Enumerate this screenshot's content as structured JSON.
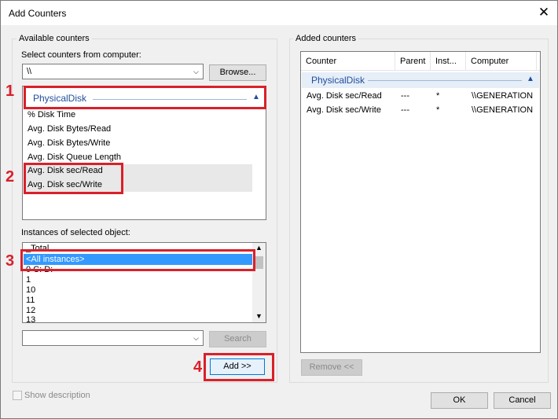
{
  "window": {
    "title": "Add Counters"
  },
  "available": {
    "group_label": "Available counters",
    "select_label": "Select counters from computer:",
    "computer_value": "\\\\",
    "browse_label": "Browse...",
    "object_name": "PhysicalDisk",
    "counters": [
      "% Disk Time",
      "Avg. Disk Bytes/Read",
      "Avg. Disk Bytes/Write",
      "Avg. Disk Queue Length",
      "Avg. Disk sec/Read",
      "Avg. Disk sec/Write"
    ],
    "instances_label": "Instances of selected object:",
    "instances": [
      "_Total",
      "<All instances>",
      "0 C: D:",
      "1",
      "10",
      "11",
      "12",
      "13"
    ],
    "search_value": "",
    "search_label": "Search",
    "add_label": "Add >>"
  },
  "added": {
    "group_label": "Added counters",
    "columns": [
      "Counter",
      "Parent",
      "Inst...",
      "Computer"
    ],
    "group_name": "PhysicalDisk",
    "rows": [
      {
        "counter": "Avg. Disk sec/Read",
        "parent": "---",
        "instance": "*",
        "computer": "\\\\GENERATION"
      },
      {
        "counter": "Avg. Disk sec/Write",
        "parent": "---",
        "instance": "*",
        "computer": "\\\\GENERATION"
      }
    ],
    "remove_label": "Remove <<"
  },
  "footer": {
    "show_description_label": "Show description",
    "ok_label": "OK",
    "cancel_label": "Cancel"
  },
  "annotations": {
    "n1": "1",
    "n2": "2",
    "n3": "3",
    "n4": "4"
  },
  "colors": {
    "highlight_red": "#d9202a",
    "selection_blue": "#3399ff",
    "header_blue": "#1f4e9c"
  }
}
